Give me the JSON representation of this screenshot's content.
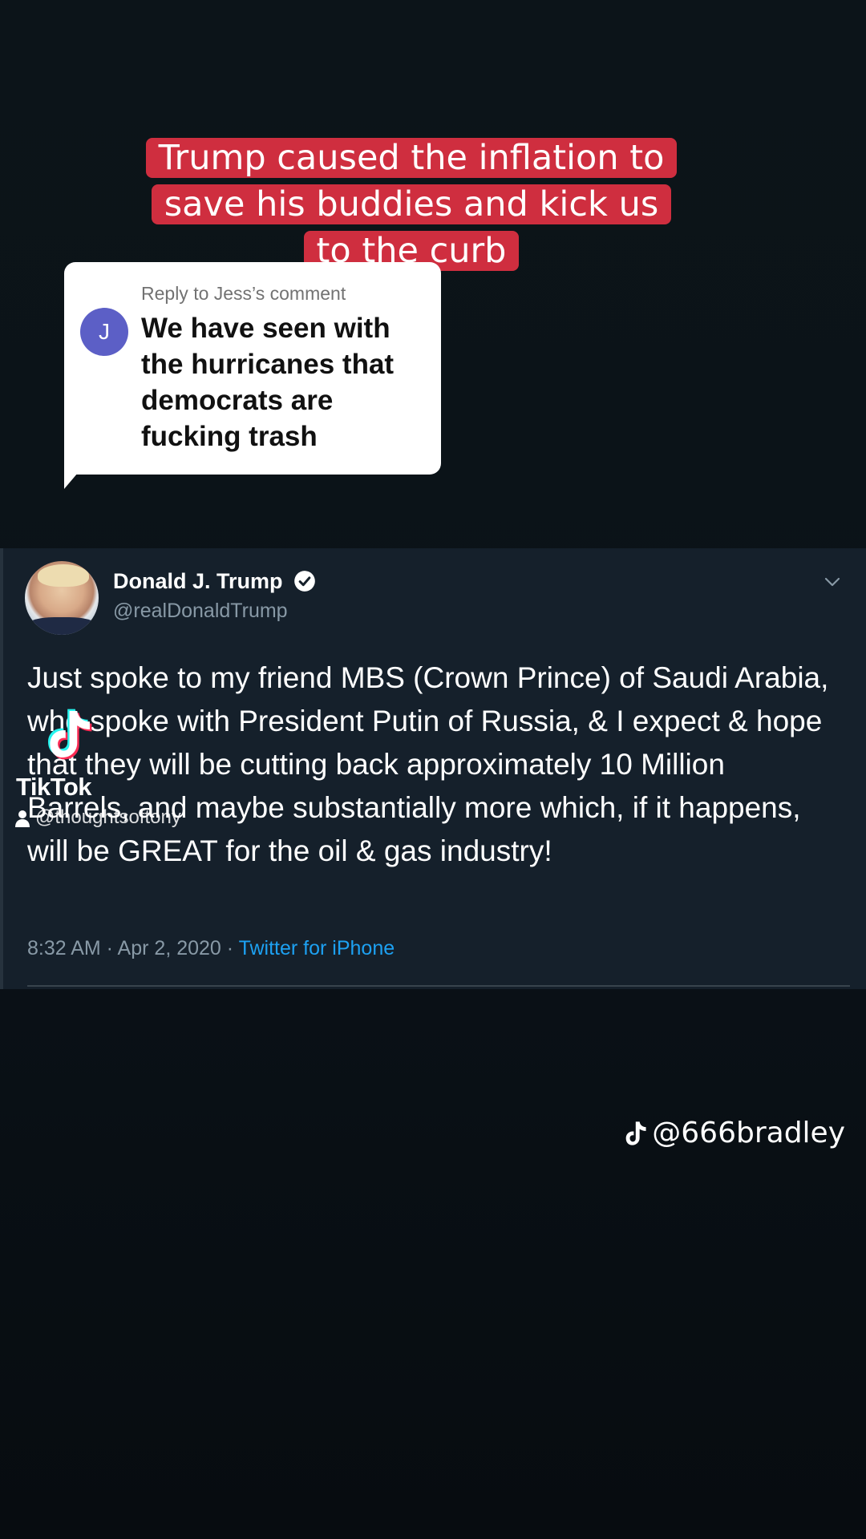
{
  "caption": {
    "lines": [
      "Trump caused the inflation to",
      "save his buddies and kick us",
      "to the curb"
    ],
    "background_color": "#cf2e3f"
  },
  "reply": {
    "meta": "Reply to Jess’s comment",
    "avatar_initial": "J",
    "avatar_color": "#5c5fc6",
    "text": "We have seen with the hurricanes that democrats are fucking trash"
  },
  "tweet": {
    "name": "Donald J. Trump",
    "handle": "@realDonaldTrump",
    "text": "Just spoke to my friend MBS (Crown Prince) of Saudi Arabia, who spoke with President Putin of Russia, & I expect & hope that they will be cutting back approximately 10 Million Barrels, and maybe substantially more which, if it happens, will be GREAT for the oil & gas industry!",
    "time": "8:32 AM · Apr 2, 2020",
    "separator": " · ",
    "client": "Twitter for iPhone",
    "verified_icon": "verified-badge-icon",
    "menu_icon": "chevron-down-icon"
  },
  "watermark": {
    "brand": "TikTok",
    "username": "@thoughtsoftony",
    "logo_icon": "tiktok-logo-icon",
    "user_icon": "user-icon"
  },
  "creator": {
    "handle": "@666bradley",
    "icon": "tiktok-note-icon"
  }
}
